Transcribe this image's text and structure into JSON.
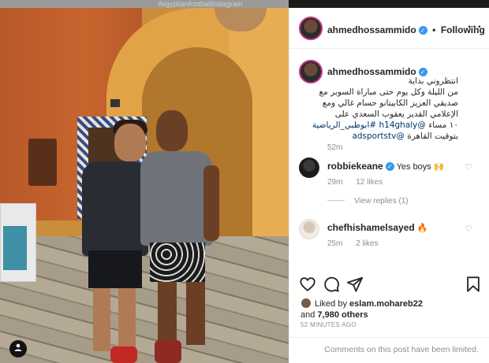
{
  "photo": {
    "watermark": "#egyptianfootballinstagram",
    "tag_icon": "user-tag-icon"
  },
  "header": {
    "username": "ahmedhossammido",
    "verified_icon": "verified-badge-icon",
    "separator": "•",
    "follow_label": "Following",
    "more_icon": "more-options-icon"
  },
  "caption": {
    "username": "ahmedhossammido",
    "line1": "انتظروني بداية",
    "line2": "من الليلة وكل يوم حتى مباراة السوبر مع",
    "line3": "صديقي العزيز الكابيتانو حسام غالي ومع",
    "line4": "الإعلامي القدير يعقوب السعدي على",
    "line5_text": "١٠ مساء",
    "line5_link": "@h14ghaly #ابوظبي_الرياضية",
    "line6_link": "@adsportstv",
    "line6_text": "بتوقيت القاهرة",
    "time": "52m"
  },
  "comments": [
    {
      "username": "robbiekeane",
      "verified": true,
      "text": "Yes boys",
      "emoji": "🙌",
      "time": "29m",
      "likes": "12 likes",
      "view_replies": "View replies (1)"
    },
    {
      "username": "chefhishamelsayed",
      "verified": false,
      "text": "",
      "emoji": "🔥",
      "time": "25m",
      "likes": "2 likes"
    }
  ],
  "actions": {
    "like_icon": "heart-icon",
    "comment_icon": "comment-icon",
    "share_icon": "share-icon",
    "save_icon": "bookmark-icon"
  },
  "likes": {
    "prefix": "Liked by",
    "user": "eslam.mohareb22",
    "joiner": "and",
    "others": "7,980 others"
  },
  "post_time": "52 MINUTES AGO",
  "limited_text": "Comments on this post have been limited.",
  "colors": {
    "link": "#00376b",
    "verified": "#3897f0",
    "muted": "#8e8e8e",
    "text": "#262626"
  }
}
